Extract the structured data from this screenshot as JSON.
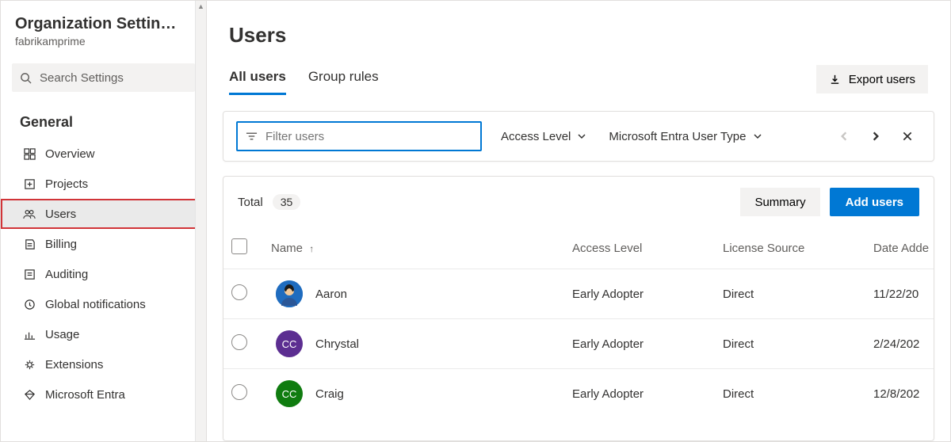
{
  "sidebar": {
    "title": "Organization Settin…",
    "subtitle": "fabrikamprime",
    "search_placeholder": "Search Settings",
    "section": "General",
    "items": [
      {
        "label": "Overview"
      },
      {
        "label": "Projects"
      },
      {
        "label": "Users"
      },
      {
        "label": "Billing"
      },
      {
        "label": "Auditing"
      },
      {
        "label": "Global notifications"
      },
      {
        "label": "Usage"
      },
      {
        "label": "Extensions"
      },
      {
        "label": "Microsoft Entra"
      }
    ]
  },
  "page": {
    "title": "Users",
    "tabs": {
      "all_users": "All users",
      "group_rules": "Group rules"
    },
    "export_label": "Export users"
  },
  "filters": {
    "placeholder": "Filter users",
    "access_level": "Access Level",
    "entra_user_type": "Microsoft Entra User Type"
  },
  "table": {
    "total_label": "Total",
    "total_count": "35",
    "summary_label": "Summary",
    "add_label": "Add users",
    "columns": {
      "name": "Name",
      "access": "Access Level",
      "license": "License Source",
      "date": "Date Adde"
    },
    "rows": [
      {
        "name": "Aaron",
        "access": "Early Adopter",
        "license": "Direct",
        "date": "11/22/20",
        "avatar_bg": "#1f6cbf",
        "avatar_initials": "",
        "avatar_type": "person"
      },
      {
        "name": "Chrystal",
        "access": "Early Adopter",
        "license": "Direct",
        "date": "2/24/202",
        "avatar_bg": "#5c2e91",
        "avatar_initials": "CC",
        "avatar_type": "initials"
      },
      {
        "name": "Craig",
        "access": "Early Adopter",
        "license": "Direct",
        "date": "12/8/202",
        "avatar_bg": "#107c10",
        "avatar_initials": "CC",
        "avatar_type": "initials"
      }
    ]
  }
}
